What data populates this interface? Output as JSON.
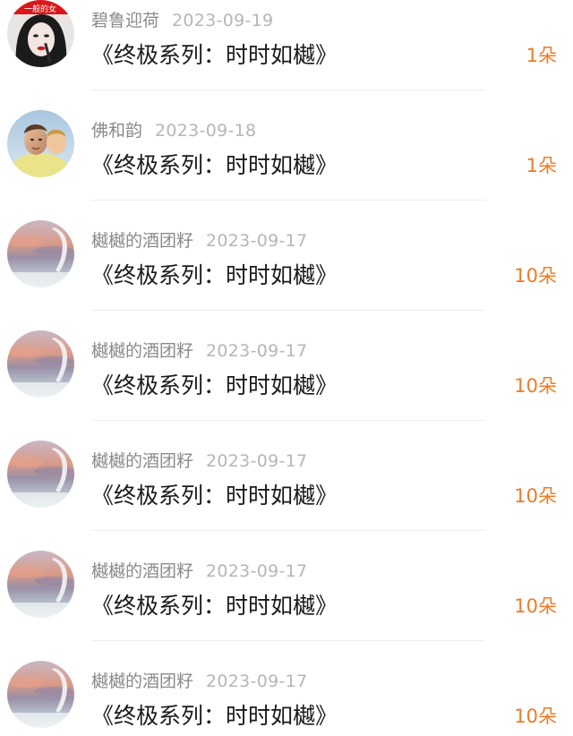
{
  "colors": {
    "accent": "#f07a26",
    "name_text": "#8a8a8a",
    "date_text": "#b6b6b6",
    "title_text": "#1a1a1a",
    "divider": "#eeeeee"
  },
  "items": [
    {
      "avatar": "woman-portrait-avatar",
      "avatar_text": "一般的女",
      "name": "碧鲁迎荷",
      "date": "2023-09-19",
      "title": "《终极系列：时时如樾》",
      "gift": "1朵"
    },
    {
      "avatar": "two-people-portrait-avatar",
      "name": "佛和韵",
      "date": "2023-09-18",
      "title": "《终极系列：时时如樾》",
      "gift": "1朵"
    },
    {
      "avatar": "sky-landscape-avatar",
      "name": "樾樾的酒团籽",
      "date": "2023-09-17",
      "title": "《终极系列：时时如樾》",
      "gift": "10朵"
    },
    {
      "avatar": "sky-landscape-avatar",
      "name": "樾樾的酒团籽",
      "date": "2023-09-17",
      "title": "《终极系列：时时如樾》",
      "gift": "10朵"
    },
    {
      "avatar": "sky-landscape-avatar",
      "name": "樾樾的酒团籽",
      "date": "2023-09-17",
      "title": "《终极系列：时时如樾》",
      "gift": "10朵"
    },
    {
      "avatar": "sky-landscape-avatar",
      "name": "樾樾的酒团籽",
      "date": "2023-09-17",
      "title": "《终极系列：时时如樾》",
      "gift": "10朵"
    },
    {
      "avatar": "sky-landscape-avatar",
      "name": "樾樾的酒团籽",
      "date": "2023-09-17",
      "title": "《终极系列：时时如樾》",
      "gift": "10朵"
    }
  ]
}
